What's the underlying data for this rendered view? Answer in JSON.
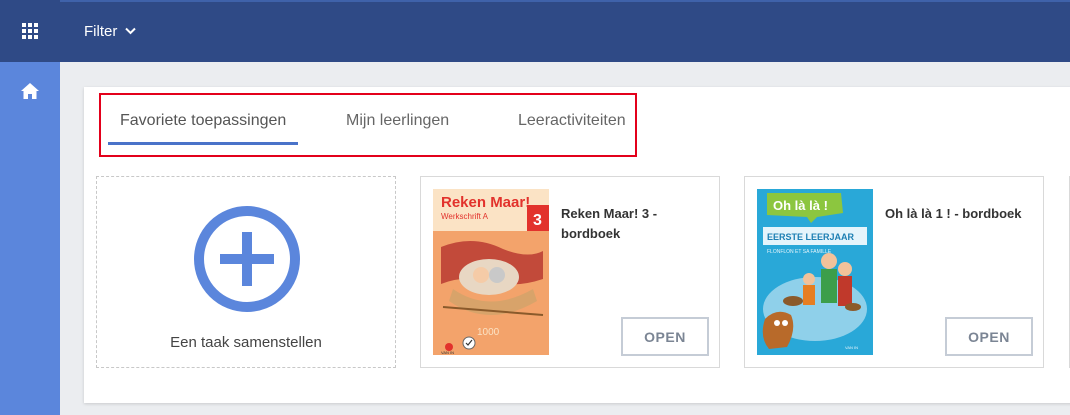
{
  "topbar": {
    "filter_label": "Filter"
  },
  "sidebar": {
    "apps_icon": "apps-grid-icon",
    "home_icon": "home-icon"
  },
  "tabs": [
    {
      "label": "Favoriete toepassingen",
      "active": true
    },
    {
      "label": "Mijn leerlingen",
      "active": false
    },
    {
      "label": "Leeractiviteiten",
      "active": false
    }
  ],
  "add_card": {
    "label": "Een taak samenstellen",
    "icon": "add-circle-icon"
  },
  "books": [
    {
      "title": "Reken Maar! 3 - bordboek",
      "button": "OPEN",
      "cover": {
        "brand": "Reken Maar!",
        "subtitle": "Werkschrift A",
        "grade": "3",
        "number": "1000",
        "publisher": "VAN IN"
      }
    },
    {
      "title": "Oh là là 1 ! - bordboek",
      "button": "OPEN",
      "cover": {
        "brand": "Oh là là !",
        "subtitle": "EERSTE LEERJAAR",
        "tagline": "FLONFLON ET SA FAMILLE",
        "publisher": "VAN IN"
      }
    }
  ],
  "colors": {
    "sidebar": "#5b86dc",
    "topbar": "#2f4a86",
    "accent": "#4a73c9",
    "highlight_box": "#e3001b"
  }
}
